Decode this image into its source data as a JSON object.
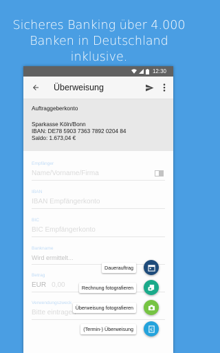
{
  "headline": {
    "line1": "Sicheres Banking über 4.000",
    "line2": "Banken in Deutschland inklusive."
  },
  "status_bar": {
    "time": "12:30"
  },
  "app_bar": {
    "title": "Überweisung",
    "icons": [
      "back-arrow-icon",
      "send-icon",
      "more-vert-icon"
    ]
  },
  "account": {
    "title": "Auftraggeberkonto",
    "bank": "Sparkasse Köln/Bonn",
    "iban": "IBAN: DE78 5903 7363 7892 0204 84",
    "balance": "Saldo: 1.673,04 €"
  },
  "form": {
    "recipient_label": "Empfänger",
    "recipient_placeholder": "Name/Vorname/Firma",
    "iban_label": "IBAN",
    "iban_placeholder": "IBAN Empfängerkonto",
    "bic_label": "BIC",
    "bic_placeholder": "BIC Empfängerkonto",
    "bankname_label": "Bankname",
    "bankname_value": "Wird ermittelt...",
    "amount_label": "Betrag",
    "currency": "EUR",
    "amount_placeholder": "0,00",
    "purpose_label": "Verwendungszweck",
    "purpose_placeholder": "Bitte eintragen"
  },
  "fab_menu": {
    "items": [
      {
        "label": "Dauerauftrag",
        "icon": "calendar-icon",
        "color": "#1e4b7a"
      },
      {
        "label": "Rechnung fotografieren",
        "icon": "invoice-camera-icon",
        "color": "#1aaa8a"
      },
      {
        "label": "Überweisung fotografieren",
        "icon": "camera-icon",
        "color": "#76c443"
      },
      {
        "label": "(Termin-) Überweisung",
        "icon": "euro-transfer-icon",
        "color": "#24a3dc"
      }
    ]
  }
}
